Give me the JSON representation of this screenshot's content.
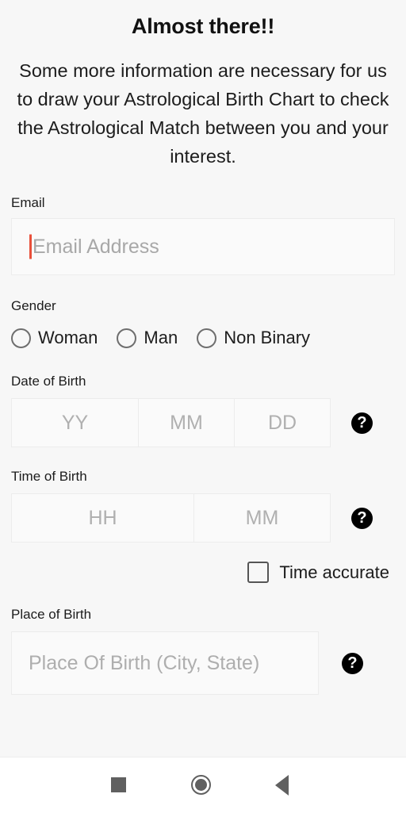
{
  "screen": {
    "title": "Almost there!!",
    "intro": "Some more information are necessary for us to draw your Astrological Birth Chart to check the Astrological Match between you and your interest."
  },
  "form": {
    "email": {
      "label": "Email",
      "placeholder": "Email Address",
      "value": "",
      "focused": true,
      "caret_color": "#e8503a"
    },
    "gender": {
      "label": "Gender",
      "selected": "",
      "options": [
        {
          "label": "Woman",
          "checked": false
        },
        {
          "label": "Man",
          "checked": false
        },
        {
          "label": "Non Binary",
          "checked": false
        }
      ]
    },
    "date_of_birth": {
      "label": "Date of Birth",
      "fields": [
        {
          "placeholder": "YY",
          "value": ""
        },
        {
          "placeholder": "MM",
          "value": ""
        },
        {
          "placeholder": "DD",
          "value": ""
        }
      ],
      "help_icon": "help-question-icon"
    },
    "time_of_birth": {
      "label": "Time of Birth",
      "fields": [
        {
          "placeholder": "HH",
          "value": ""
        },
        {
          "placeholder": "MM",
          "value": ""
        }
      ],
      "help_icon": "help-question-icon",
      "accurate_checkbox": {
        "label": "Time accurate",
        "checked": false
      }
    },
    "place_of_birth": {
      "label": "Place of Birth",
      "placeholder": "Place Of Birth (City, State)",
      "value": "",
      "help_icon": "help-question-icon"
    }
  },
  "help_glyph": "?",
  "navbar": {
    "recents_label": "recents-square-icon",
    "home_label": "home-circle-icon",
    "back_label": "back-triangle-icon"
  }
}
